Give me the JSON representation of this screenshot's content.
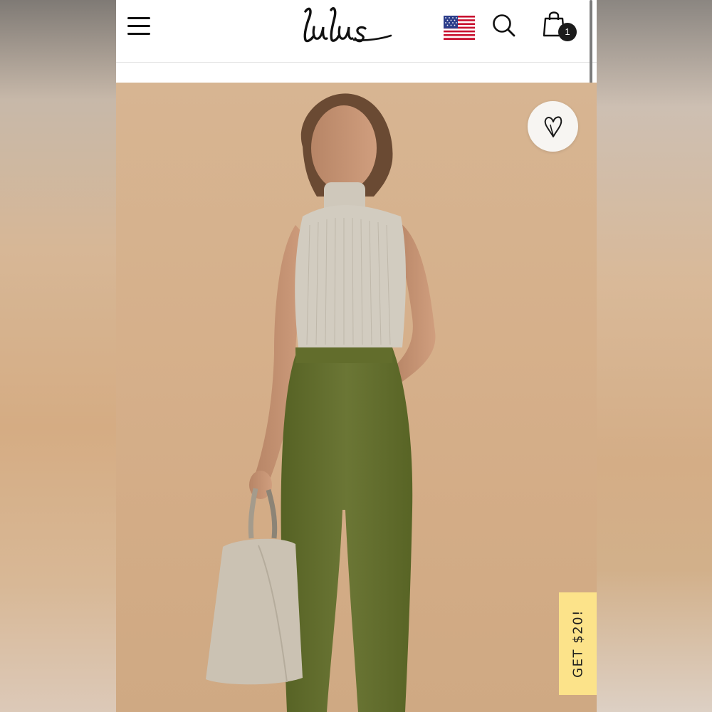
{
  "header": {
    "logo_text": "lulus",
    "menu_icon": "hamburger-menu-icon",
    "flag_icon": "us-flag-icon",
    "search_icon": "search-icon",
    "cart_icon": "shopping-bag-icon",
    "cart_count": "1"
  },
  "product": {
    "favorite_icon": "heart-icon"
  },
  "promo": {
    "label": "GET $20!",
    "color": "#fce38a"
  }
}
